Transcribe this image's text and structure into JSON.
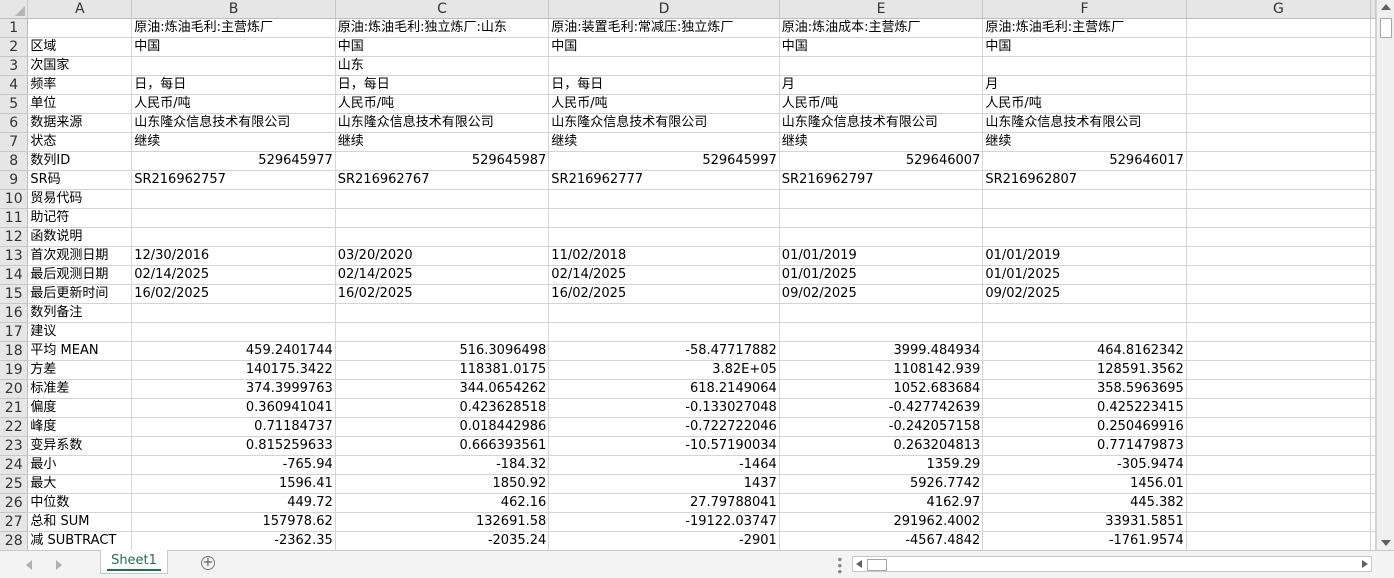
{
  "columns": [
    "A",
    "B",
    "C",
    "D",
    "E",
    "F",
    "G"
  ],
  "rows": [
    {
      "n": "1",
      "cells": [
        "",
        "原油:炼油毛利:主营炼厂",
        "原油:炼油毛利:独立炼厂:山东",
        "原油:装置毛利:常减压:独立炼厂",
        "原油:炼油成本:主营炼厂",
        "原油:炼油毛利:主营炼厂",
        ""
      ]
    },
    {
      "n": "2",
      "cells": [
        "区域",
        "中国",
        "中国",
        "中国",
        "中国",
        "中国",
        ""
      ]
    },
    {
      "n": "3",
      "cells": [
        "次国家",
        "",
        "山东",
        "",
        "",
        "",
        ""
      ]
    },
    {
      "n": "4",
      "cells": [
        "频率",
        "日，每日",
        "日，每日",
        "日，每日",
        "月",
        "月",
        ""
      ]
    },
    {
      "n": "5",
      "cells": [
        "单位",
        "人民币/吨",
        "人民币/吨",
        "人民币/吨",
        "人民币/吨",
        "人民币/吨",
        ""
      ]
    },
    {
      "n": "6",
      "cells": [
        "数据来源",
        "山东隆众信息技术有限公司",
        "山东隆众信息技术有限公司",
        "山东隆众信息技术有限公司",
        "山东隆众信息技术有限公司",
        "山东隆众信息技术有限公司",
        ""
      ]
    },
    {
      "n": "7",
      "cells": [
        "状态",
        "继续",
        "继续",
        "继续",
        "继续",
        "继续",
        ""
      ]
    },
    {
      "n": "8",
      "cells": [
        "数列ID",
        "529645977",
        "529645987",
        "529645997",
        "529646007",
        "529646017",
        ""
      ],
      "num": true
    },
    {
      "n": "9",
      "cells": [
        "SR码",
        "SR216962757",
        "SR216962767",
        "SR216962777",
        "SR216962797",
        "SR216962807",
        ""
      ]
    },
    {
      "n": "10",
      "cells": [
        "贸易代码",
        "",
        "",
        "",
        "",
        "",
        ""
      ]
    },
    {
      "n": "11",
      "cells": [
        "助记符",
        "",
        "",
        "",
        "",
        "",
        ""
      ]
    },
    {
      "n": "12",
      "cells": [
        "函数说明",
        "",
        "",
        "",
        "",
        "",
        ""
      ]
    },
    {
      "n": "13",
      "cells": [
        "首次观测日期",
        "12/30/2016",
        "03/20/2020",
        "11/02/2018",
        "01/01/2019",
        "01/01/2019",
        ""
      ]
    },
    {
      "n": "14",
      "cells": [
        "最后观测日期",
        "02/14/2025",
        "02/14/2025",
        "02/14/2025",
        "01/01/2025",
        "01/01/2025",
        ""
      ]
    },
    {
      "n": "15",
      "cells": [
        "最后更新时间",
        "16/02/2025",
        "16/02/2025",
        "16/02/2025",
        "09/02/2025",
        "09/02/2025",
        ""
      ]
    },
    {
      "n": "16",
      "cells": [
        "数列备注",
        "",
        "",
        "",
        "",
        "",
        ""
      ]
    },
    {
      "n": "17",
      "cells": [
        "建议",
        "",
        "",
        "",
        "",
        "",
        ""
      ]
    },
    {
      "n": "18",
      "cells": [
        "平均 MEAN",
        "459.2401744",
        "516.3096498",
        "-58.47717882",
        "3999.484934",
        "464.8162342",
        ""
      ],
      "num": true
    },
    {
      "n": "19",
      "cells": [
        "方差",
        "140175.3422",
        "118381.0175",
        "3.82E+05",
        "1108142.939",
        "128591.3562",
        ""
      ],
      "num": true
    },
    {
      "n": "20",
      "cells": [
        "标准差",
        "374.3999763",
        "344.0654262",
        "618.2149064",
        "1052.683684",
        "358.5963695",
        ""
      ],
      "num": true
    },
    {
      "n": "21",
      "cells": [
        "偏度",
        "0.360941041",
        "0.423628518",
        "-0.133027048",
        "-0.427742639",
        "0.425223415",
        ""
      ],
      "num": true
    },
    {
      "n": "22",
      "cells": [
        "峰度",
        "0.71184737",
        "0.018442986",
        "-0.722722046",
        "-0.242057158",
        "0.250469916",
        ""
      ],
      "num": true
    },
    {
      "n": "23",
      "cells": [
        "变异系数",
        "0.815259633",
        "0.666393561",
        "-10.57190034",
        "0.263204813",
        "0.771479873",
        ""
      ],
      "num": true
    },
    {
      "n": "24",
      "cells": [
        "最小",
        "-765.94",
        "-184.32",
        "-1464",
        "1359.29",
        "-305.9474",
        ""
      ],
      "num": true
    },
    {
      "n": "25",
      "cells": [
        "最大",
        "1596.41",
        "1850.92",
        "1437",
        "5926.7742",
        "1456.01",
        ""
      ],
      "num": true
    },
    {
      "n": "26",
      "cells": [
        "中位数",
        "449.72",
        "462.16",
        "27.79788041",
        "4162.97",
        "445.382",
        ""
      ],
      "num": true
    },
    {
      "n": "27",
      "cells": [
        "总和 SUM",
        "157978.62",
        "132691.58",
        "-19122.03747",
        "291962.4002",
        "33931.5851",
        ""
      ],
      "num": true
    },
    {
      "n": "28",
      "cells": [
        "减 SUBTRACT",
        "-2362.35",
        "-2035.24",
        "-2901",
        "-4567.4842",
        "-1761.9574",
        ""
      ],
      "num": true
    }
  ],
  "sheet_tab": "Sheet1",
  "add_sheet_symbol": "+",
  "colors": {
    "header_bg": "#e6e6e6",
    "gridline": "#d4d4d4",
    "tab_accent": "#217346"
  }
}
